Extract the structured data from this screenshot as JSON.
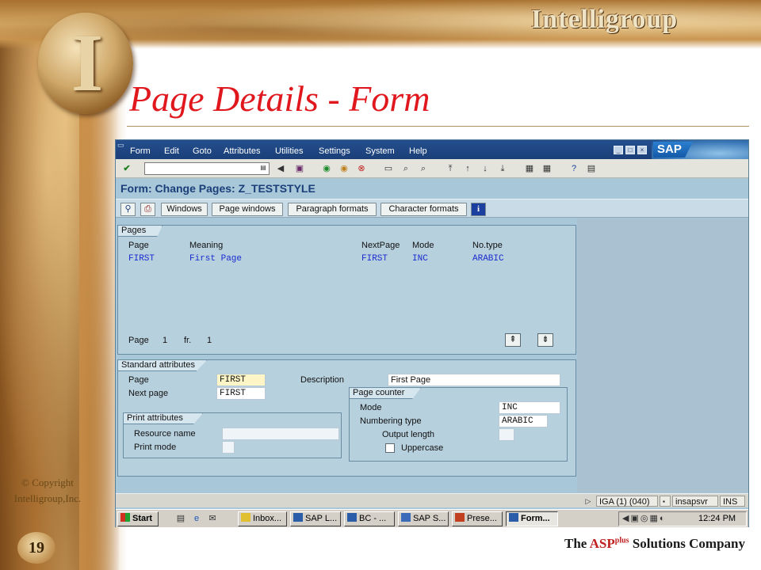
{
  "slide": {
    "brand": "Intelligroup",
    "logo_letter": "I",
    "title": "Page Details - Form",
    "copyright": "© Copyright Intelligroup,Inc.",
    "page_number": "19",
    "tagline_pre": "The ",
    "tagline_asp": "ASP",
    "tagline_plus": "plus",
    "tagline_post": " Solutions Company"
  },
  "sap": {
    "menu": [
      "Form",
      "Edit",
      "Goto",
      "Attributes",
      "Utilities",
      "Settings",
      "System",
      "Help"
    ],
    "logo": "SAP",
    "screen_title": "Form: Change Pages: Z_TESTSTYLE",
    "app_buttons": [
      "Windows",
      "Page windows",
      "Paragraph formats",
      "Character formats"
    ],
    "pages": {
      "label": "Pages",
      "columns": [
        "Page",
        "Meaning",
        "NextPage",
        "Mode",
        "No.type"
      ],
      "row": [
        "FIRST",
        "First Page",
        "FIRST",
        "INC",
        "ARABIC"
      ],
      "footer_page_label": "Page",
      "footer_page_value": "1",
      "footer_fr_label": "fr.",
      "footer_fr_value": "1"
    },
    "standard": {
      "label": "Standard attributes",
      "page_label": "Page",
      "page_value": "FIRST",
      "next_label": "Next page",
      "next_value": "FIRST",
      "desc_label": "Description",
      "desc_value": "First Page"
    },
    "print": {
      "label": "Print attributes",
      "resource_label": "Resource name",
      "resource_value": "",
      "mode_label": "Print mode",
      "mode_value": ""
    },
    "counter": {
      "label": "Page counter",
      "mode_label": "Mode",
      "mode_value": "INC",
      "numtype_label": "Numbering type",
      "numtype_value": "ARABIC",
      "outlen_label": "Output length",
      "outlen_value": "",
      "uppercase_label": "Uppercase",
      "uppercase_checked": false
    },
    "status": {
      "system": "IGA (1) (040)",
      "server": "insapsvr",
      "mode": "INS"
    },
    "taskbar": {
      "start": "Start",
      "tasks": [
        "Inbox...",
        "SAP L...",
        "BC - ...",
        "SAP S...",
        "Prese...",
        "Form..."
      ],
      "clock": "12:24 PM"
    }
  }
}
